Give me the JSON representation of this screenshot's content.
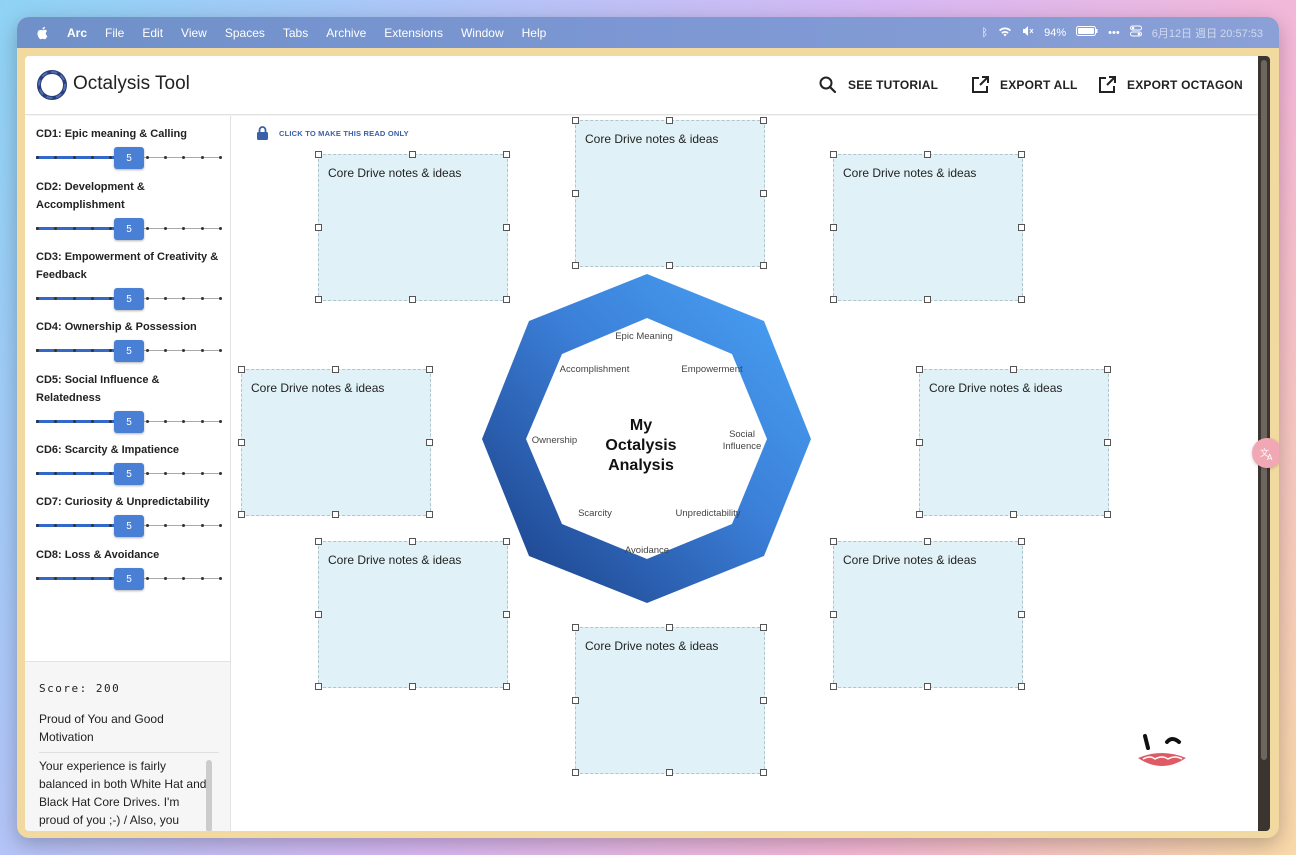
{
  "menubar": {
    "app": "Arc",
    "items": [
      "File",
      "Edit",
      "View",
      "Spaces",
      "Tabs",
      "Archive",
      "Extensions",
      "Window",
      "Help"
    ],
    "battery": "94%",
    "datetime": "6月12日 週日  20:57:53"
  },
  "header": {
    "title": "Octalysis Tool",
    "see_tutorial": "SEE TUTORIAL",
    "export_all": "EXPORT ALL",
    "export_octagon": "EXPORT OCTAGON"
  },
  "sidebar": {
    "drives": [
      {
        "label": "CD1: Epic meaning & Calling",
        "value": "5",
        "level": 5
      },
      {
        "label": "CD2: Development & Accomplishment",
        "value": "5",
        "level": 5
      },
      {
        "label": "CD3: Empowerment of Creativity & Feedback",
        "value": "5",
        "level": 5
      },
      {
        "label": "CD4: Ownership & Possession",
        "value": "5",
        "level": 5
      },
      {
        "label": "CD5: Social Influence & Relatedness",
        "value": "5",
        "level": 5
      },
      {
        "label": "CD6: Scarcity & Impatience",
        "value": "5",
        "level": 5
      },
      {
        "label": "CD7: Curiosity & Unpredictability",
        "value": "5",
        "level": 5
      },
      {
        "label": "CD8: Loss & Avoidance",
        "value": "5",
        "level": 5
      }
    ],
    "slider_max": 10,
    "score": "Score: 200",
    "verdict": "Proud of You and Good Motivation",
    "description": "Your experience is fairly balanced in both White Hat and Black Hat Core Drives. I'm proud of you ;-) / Also, you seem to have a great balance between Left Brain and Right Brain Core Drives, which means you likely have a good"
  },
  "canvas": {
    "lock_text": "CLICK TO MAKE THIS READ ONLY",
    "note_placeholder": "Core Drive notes & ideas",
    "octagon": {
      "title_line1": "My",
      "title_line2": "Octalysis",
      "title_line3": "Analysis",
      "labels": {
        "top": "Epic Meaning",
        "top_left": "Accomplishment",
        "top_right": "Empowerment",
        "left": "Ownership",
        "right_line1": "Social",
        "right_line2": "Influence",
        "bottom_left": "Scarcity",
        "bottom_right": "Unpredictability",
        "bottom": "Avoidance"
      }
    }
  },
  "colors": {
    "accent": "#4a7fd6",
    "note_bg": "#e0f2f7",
    "octagon_light": "#4a9cf0",
    "octagon_dark": "#1d3f8a"
  }
}
